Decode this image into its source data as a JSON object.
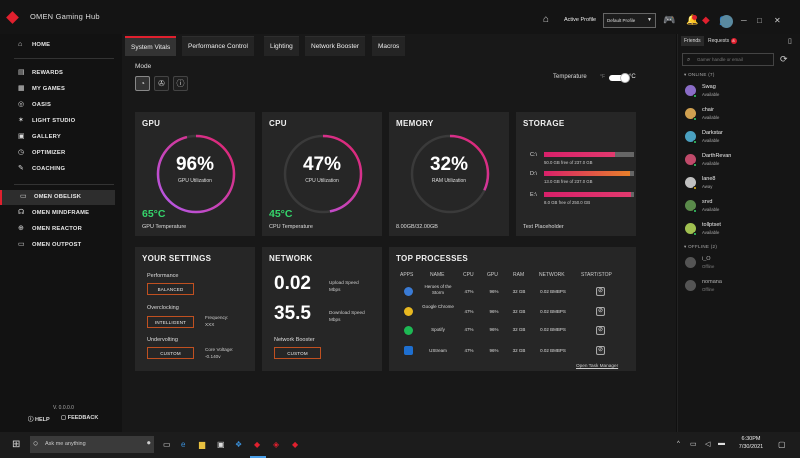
{
  "titlebar": {
    "app_title": "OMEN Gaming Hub",
    "active_profile_label": "Active Profile",
    "profile_value": "Default Profile",
    "notification_badge_1": "",
    "notification_badge_2": "",
    "accent": "#e0202e"
  },
  "sidebar": {
    "items": [
      {
        "label": "HOME",
        "icon": "home-icon"
      },
      {
        "label": "REWARDS",
        "icon": "rewards-icon"
      },
      {
        "label": "MY GAMES",
        "icon": "games-icon"
      },
      {
        "label": "OASIS",
        "icon": "oasis-icon"
      },
      {
        "label": "LIGHT STUDIO",
        "icon": "light-icon"
      },
      {
        "label": "GALLERY",
        "icon": "gallery-icon"
      },
      {
        "label": "OPTIMIZER",
        "icon": "optimizer-icon"
      },
      {
        "label": "COACHING",
        "icon": "coaching-icon"
      },
      {
        "label": "OMEN OBELISK",
        "icon": "desktop-icon"
      },
      {
        "label": "OMEN MINDFRAME",
        "icon": "headset-icon"
      },
      {
        "label": "OMEN REACTOR",
        "icon": "mouse-icon"
      },
      {
        "label": "OMEN OUTPOST",
        "icon": "mousepad-icon"
      }
    ],
    "version": "V. 0.0.0.0",
    "help": "HELP",
    "feedback": "FEEDBACK"
  },
  "tabs": [
    "System Vitals",
    "Performance Control",
    "Lighting",
    "Network Booster",
    "Macros"
  ],
  "mode": {
    "label": "Mode",
    "temperature_label": "Temperature",
    "unit_f": "°F",
    "unit_c": "°C"
  },
  "gpu": {
    "title": "GPU",
    "percent": "96%",
    "sub": "GPU Utilization",
    "temp": "65°C",
    "temp_label": "GPU Temperature",
    "fraction": 0.96
  },
  "cpu": {
    "title": "CPU",
    "percent": "47%",
    "sub": "CPU Utilization",
    "temp": "45°C",
    "temp_label": "CPU Temperature",
    "fraction": 0.47
  },
  "memory": {
    "title": "MEMORY",
    "percent": "32%",
    "sub": "RAM Utilization",
    "usage": "8.00GB/32.00GB",
    "fraction": 0.32
  },
  "storage": {
    "title": "STORAGE",
    "drives": [
      {
        "label": "C:\\",
        "info": "50.0 GB free of 237.0 GB",
        "used": 0.79,
        "color": "#e23a6e"
      },
      {
        "label": "D:\\",
        "info": "13.0 GB free of 237.0 GB",
        "used": 0.95,
        "color": "#e8802a"
      },
      {
        "label": "E:\\",
        "info": "8.0 GB free of 250.0 GB",
        "used": 0.97,
        "color": "#e23a6e"
      }
    ],
    "placeholder": "Text Placeholder"
  },
  "settings": {
    "title": "YOUR SETTINGS",
    "performance_label": "Performance",
    "performance_value": "BALANCED",
    "overclocking_label": "Overclocking",
    "overclocking_value": "INTELLIGENT",
    "frequency_label": "Frequency:",
    "frequency_value": "XXX",
    "undervolting_label": "Undervolting",
    "undervolting_value": "CUSTOM",
    "core_voltage_label": "Core Voltage:",
    "core_voltage_value": "-0.140v"
  },
  "network": {
    "title": "NETWORK",
    "upload_value": "0.02",
    "upload_label": "Upload Speed",
    "upload_unit": "Mbps",
    "download_value": "35.5",
    "download_label": "Download Speed",
    "download_unit": "Mbps",
    "booster_label": "Network Booster",
    "booster_value": "CUSTOM"
  },
  "processes": {
    "title": "TOP PROCESSES",
    "headers": [
      "APPS",
      "NAME",
      "CPU",
      "GPU",
      "RAM",
      "NETWORK",
      "START/STOP"
    ],
    "rows": [
      {
        "name": "Heroes of the Storm",
        "cpu": "47%",
        "gpu": "96%",
        "ram": "32 GB",
        "network": "0.02 BMBPS",
        "icon_color": "#3a7bd5"
      },
      {
        "name": "Google Chrome",
        "cpu": "47%",
        "gpu": "96%",
        "ram": "32 GB",
        "network": "0.02 BMBPS",
        "icon_color": "#e8b820"
      },
      {
        "name": "Spotify",
        "cpu": "47%",
        "gpu": "96%",
        "ram": "32 GB",
        "network": "0.02 BMBPS",
        "icon_color": "#1db954"
      },
      {
        "name": "UStream",
        "cpu": "47%",
        "gpu": "96%",
        "ram": "32 GB",
        "network": "0.02 BMBPS",
        "icon_color": "#1e6fd0"
      }
    ],
    "task_link": "Open Task Manager"
  },
  "friends": {
    "tab_friends": "Friends",
    "tab_requests": "Requests",
    "requests_count": "8",
    "search_placeholder": "Gamer handle or email",
    "online_header": "ONLINE (7)",
    "offline_header": "OFFLINE (2)",
    "online": [
      {
        "name": "Swag",
        "status": "Available",
        "color": "#8a6cc7"
      },
      {
        "name": "chair",
        "status": "Available",
        "color": "#d0a050"
      },
      {
        "name": "Darkstar",
        "status": "Available",
        "color": "#4aa0c0"
      },
      {
        "name": "DarthRevan",
        "status": "Available",
        "color": "#c04a6a"
      },
      {
        "name": "lane8",
        "status": "Away",
        "color": "#c0c0c0"
      },
      {
        "name": "srvd",
        "status": "Available",
        "color": "#5a8a4a"
      },
      {
        "name": "tollptset",
        "status": "Available",
        "color": "#a0c050"
      }
    ],
    "offline": [
      {
        "name": "i_O",
        "status": "Offline",
        "color": "#707070"
      },
      {
        "name": "nomana",
        "status": "Offline",
        "color": "#707070"
      }
    ]
  },
  "taskbar": {
    "search_placeholder": "Ask me anything",
    "time": "6:30PM",
    "date": "7/30/2021"
  }
}
